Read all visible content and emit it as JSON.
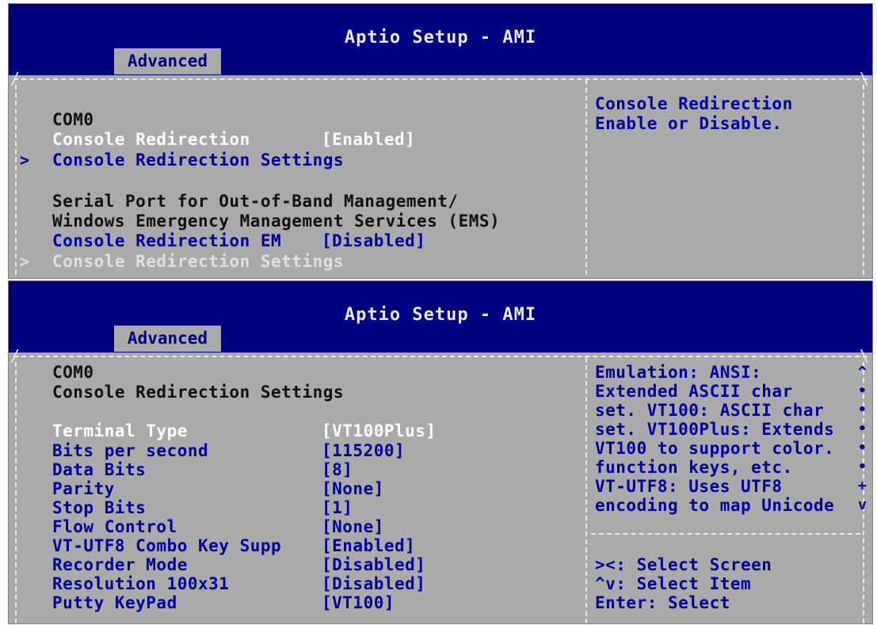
{
  "panel1": {
    "title": "Aptio Setup - AMI",
    "tab": "Advanced",
    "items": {
      "com_header": "COM0",
      "redir_label": "Console Redirection",
      "redir_value": "[Enabled]",
      "redir_settings": "Console Redirection Settings",
      "serial_line1": "Serial Port for Out-of-Band Management/",
      "serial_line2": "Windows Emergency Management Services (EMS)",
      "em_label": "Console Redirection EM",
      "em_value": "[Disabled]",
      "em_settings": "Console Redirection Settings"
    },
    "help": [
      "Console Redirection",
      "Enable or Disable."
    ]
  },
  "panel2": {
    "title": "Aptio Setup - AMI",
    "tab": "Advanced",
    "header1": "COM0",
    "header2": "Console Redirection Settings",
    "settings": [
      {
        "label": "Terminal Type",
        "value": "[VT100Plus]"
      },
      {
        "label": "Bits per second",
        "value": "[115200]"
      },
      {
        "label": "Data Bits",
        "value": "[8]"
      },
      {
        "label": "Parity",
        "value": "[None]"
      },
      {
        "label": "Stop Bits",
        "value": "[1]"
      },
      {
        "label": "Flow Control",
        "value": "[None]"
      },
      {
        "label": "VT-UTF8 Combo Key Supp",
        "value": "[Enabled]"
      },
      {
        "label": "Recorder Mode",
        "value": "[Disabled]"
      },
      {
        "label": "Resolution 100x31",
        "value": "[Disabled]"
      },
      {
        "label": "Putty KeyPad",
        "value": "[VT100]"
      }
    ],
    "help": [
      "Emulation: ANSI:",
      "Extended ASCII char",
      "set. VT100: ASCII char",
      "set. VT100Plus: Extends",
      "VT100 to support color.",
      "function keys, etc.",
      "VT-UTF8: Uses UTF8",
      "encoding to map Unicode"
    ],
    "scroll_marks": [
      "^",
      "•",
      "•",
      "•",
      "•",
      "•",
      "+",
      "v"
    ],
    "keys": [
      "><: Select Screen",
      "^v: Select Item",
      "Enter: Select"
    ]
  }
}
